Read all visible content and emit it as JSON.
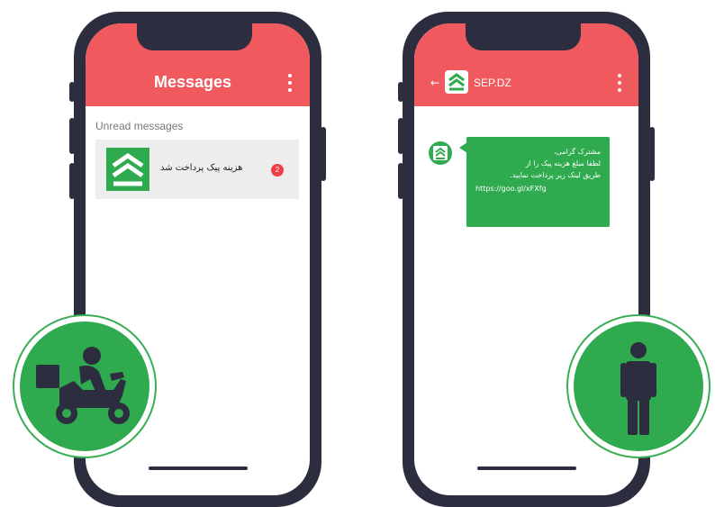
{
  "left_phone": {
    "appbar": {
      "title": "Messages",
      "menu_icon": "kebab-menu-icon"
    },
    "section_label": "Unread messages",
    "message": {
      "text": "هزینه پیک پرداخت شد",
      "unread_count": "2",
      "logo_icon": "chevron-logo-icon"
    }
  },
  "right_phone": {
    "appbar": {
      "sender": "SEP.DZ",
      "back_icon": "back-arrow-icon",
      "menu_icon": "kebab-menu-icon"
    },
    "bubble": {
      "line1": "مشترک گرامی،",
      "line2": "لطفا مبلغ هزینه پیک را از",
      "line3": "طریق لینک زیر پرداخت نمایید.",
      "link": "https://goo.gl/xFXfg"
    }
  },
  "badges": {
    "left_icon": "delivery-scooter-icon",
    "right_icon": "person-icon"
  },
  "colors": {
    "accent_red": "#f05a5e",
    "brand_green": "#2faa4f",
    "phone_frame": "#2c2d3f"
  }
}
